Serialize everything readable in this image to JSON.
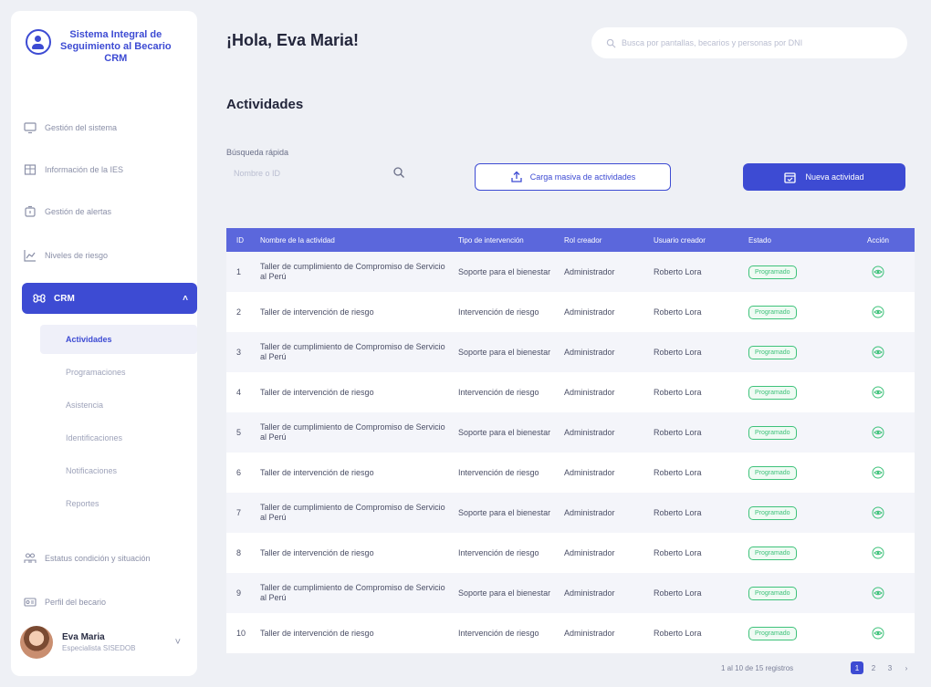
{
  "brand": {
    "line1": "Sistema Integral de",
    "line2": "Seguimiento al Becario",
    "line3": "CRM"
  },
  "sidebar": {
    "items": [
      {
        "label": "Gestión del sistema",
        "icon": "monitor-icon"
      },
      {
        "label": "Información de la IES",
        "icon": "building-icon"
      },
      {
        "label": "Gestión de alertas",
        "icon": "box-icon"
      },
      {
        "label": "Niveles de riesgo",
        "icon": "chart-line-icon"
      },
      {
        "label": "CRM",
        "icon": "command-icon"
      },
      {
        "label": "Estatus condición y situación",
        "icon": "people-icon"
      },
      {
        "label": "Perfil del becario",
        "icon": "id-card-icon"
      }
    ],
    "crm_submenu": [
      "Actividades",
      "Programaciones",
      "Asistencia",
      "Identificaciones",
      "Notificaciones",
      "Reportes"
    ]
  },
  "user": {
    "name": "Eva Maria",
    "role": "Especialista SISEDOB"
  },
  "header": {
    "greeting": "¡Hola, Eva Maria!",
    "search_placeholder": "Busca por pantallas, becarios y personas por DNI"
  },
  "main": {
    "title": "Actividades",
    "quick_search_label": "Búsqueda rápida",
    "quick_search_placeholder": "Nombre o ID",
    "upload_button": "Carga masiva de actividades",
    "new_button": "Nueva actividad"
  },
  "table": {
    "headers": [
      "ID",
      "Nombre de la actividad",
      "Tipo de intervención",
      "Rol creador",
      "Usuario creador",
      "Estado",
      "Acción"
    ],
    "rows": [
      {
        "id": "1",
        "name": "Taller de cumplimiento de Compromiso de Servicio al Perú",
        "type": "Soporte para el bienestar",
        "rol": "Administrador",
        "user": "Roberto Lora",
        "state": "Programado"
      },
      {
        "id": "2",
        "name": "Taller de intervención de riesgo",
        "type": "Intervención de riesgo",
        "rol": "Administrador",
        "user": "Roberto Lora",
        "state": "Programado"
      },
      {
        "id": "3",
        "name": "Taller de cumplimiento de Compromiso de Servicio al Perú",
        "type": "Soporte para el bienestar",
        "rol": "Administrador",
        "user": "Roberto Lora",
        "state": "Programado"
      },
      {
        "id": "4",
        "name": "Taller de intervención de riesgo",
        "type": "Intervención de riesgo",
        "rol": "Administrador",
        "user": "Roberto Lora",
        "state": "Programado"
      },
      {
        "id": "5",
        "name": "Taller de cumplimiento de Compromiso de Servicio al Perú",
        "type": "Soporte para el bienestar",
        "rol": "Administrador",
        "user": "Roberto Lora",
        "state": "Programado"
      },
      {
        "id": "6",
        "name": "Taller de intervención de riesgo",
        "type": "Intervención de riesgo",
        "rol": "Administrador",
        "user": "Roberto Lora",
        "state": "Programado"
      },
      {
        "id": "7",
        "name": "Taller de cumplimiento de Compromiso de Servicio al Perú",
        "type": "Soporte para el bienestar",
        "rol": "Administrador",
        "user": "Roberto Lora",
        "state": "Programado"
      },
      {
        "id": "8",
        "name": "Taller de intervención de riesgo",
        "type": "Intervención de riesgo",
        "rol": "Administrador",
        "user": "Roberto Lora",
        "state": "Programado"
      },
      {
        "id": "9",
        "name": "Taller de cumplimiento de Compromiso de Servicio al Perú",
        "type": "Soporte para el bienestar",
        "rol": "Administrador",
        "user": "Roberto Lora",
        "state": "Programado"
      },
      {
        "id": "10",
        "name": "Taller de intervención de riesgo",
        "type": "Intervención de riesgo",
        "rol": "Administrador",
        "user": "Roberto Lora",
        "state": "Programado"
      }
    ]
  },
  "pagination": {
    "info": "1 al 10 de 15 registros",
    "pages": [
      "1",
      "2",
      "3"
    ],
    "next": "›",
    "current": "1"
  },
  "colors": {
    "primary": "#3d4bd3",
    "header": "#5b67dc",
    "success": "#3ec27a",
    "background": "#eef0f5"
  }
}
